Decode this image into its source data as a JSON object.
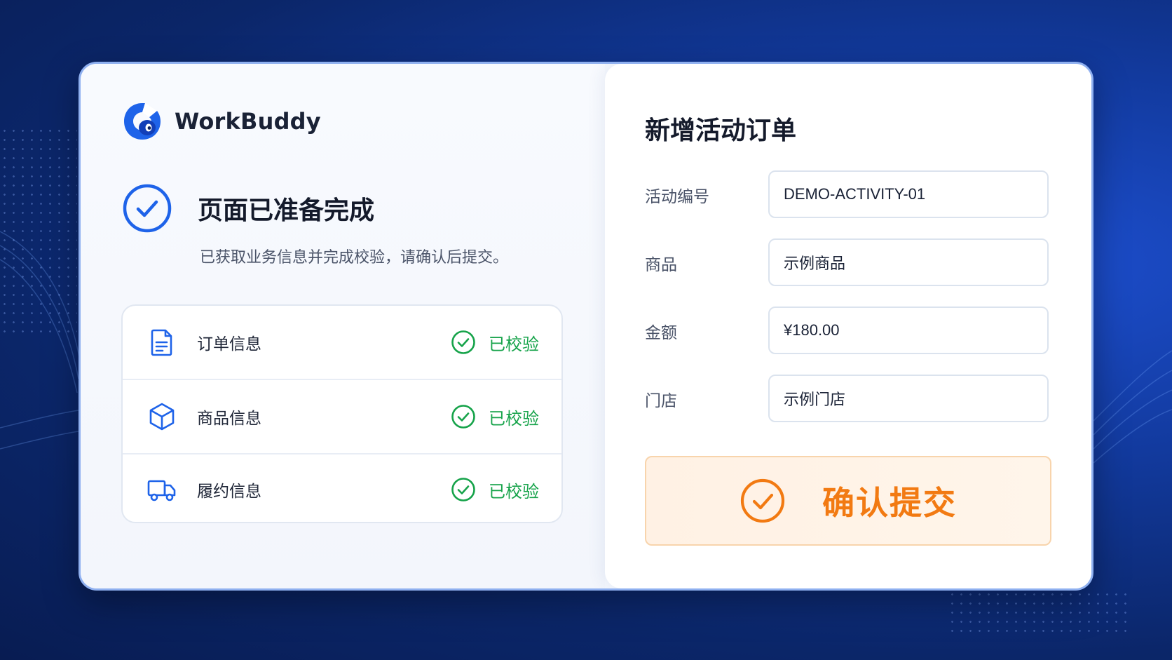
{
  "app": {
    "name": "WorkBuddy"
  },
  "status": {
    "title": "页面已准备完成",
    "description": "已获取业务信息并完成校验，请确认后提交。"
  },
  "checklist": [
    {
      "label": "订单信息",
      "status": "已校验",
      "icon": "document-icon"
    },
    {
      "label": "商品信息",
      "status": "已校验",
      "icon": "box-icon"
    },
    {
      "label": "履约信息",
      "status": "已校验",
      "icon": "truck-icon"
    }
  ],
  "form": {
    "title": "新增活动订单",
    "fields": [
      {
        "label": "活动编号",
        "value": "DEMO-ACTIVITY-01"
      },
      {
        "label": "商品",
        "value": "示例商品"
      },
      {
        "label": "金额",
        "value": "¥180.00"
      },
      {
        "label": "门店",
        "value": "示例门店"
      }
    ],
    "submit_label": "确认提交"
  },
  "colors": {
    "brand_blue": "#1e63e9",
    "success_green": "#16a34a",
    "accent_orange": "#f27a12",
    "background_navy": "#0b2669"
  }
}
